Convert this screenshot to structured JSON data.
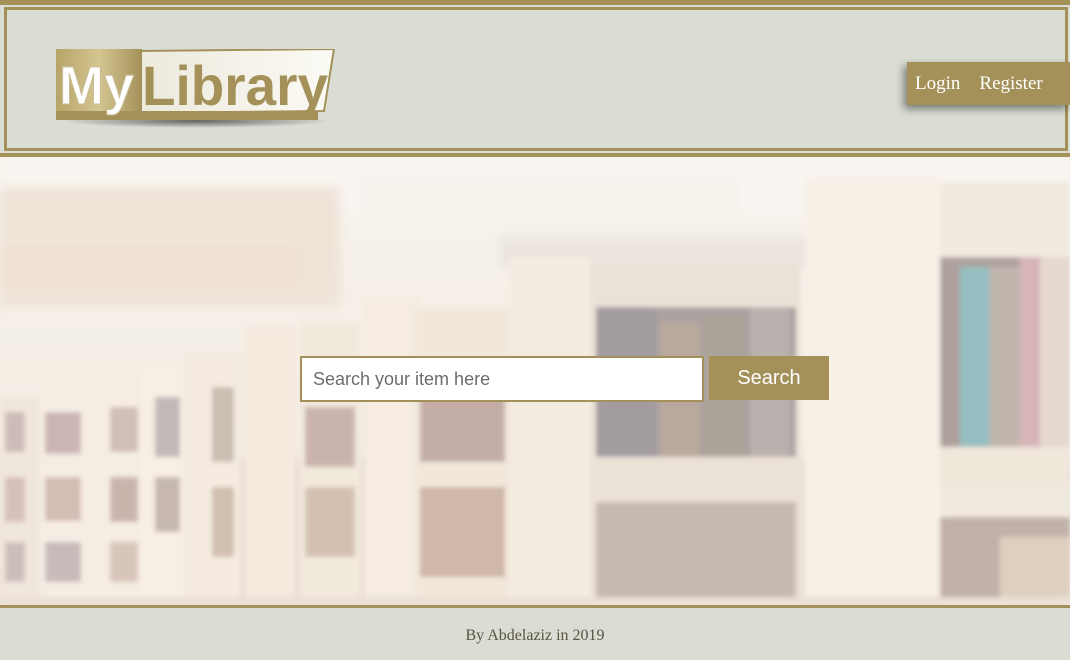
{
  "header": {
    "logo": {
      "part1": "My",
      "part2": "Library"
    },
    "nav": {
      "login_label": "Login",
      "register_label": "Register"
    }
  },
  "search": {
    "placeholder": "Search your item here",
    "value": "",
    "button_label": "Search"
  },
  "footer": {
    "text": "By Abdelaziz in 2019"
  },
  "colors": {
    "accent": "#a4915a",
    "panel_background": "#d9ddd4",
    "button_text": "#ffffff"
  }
}
